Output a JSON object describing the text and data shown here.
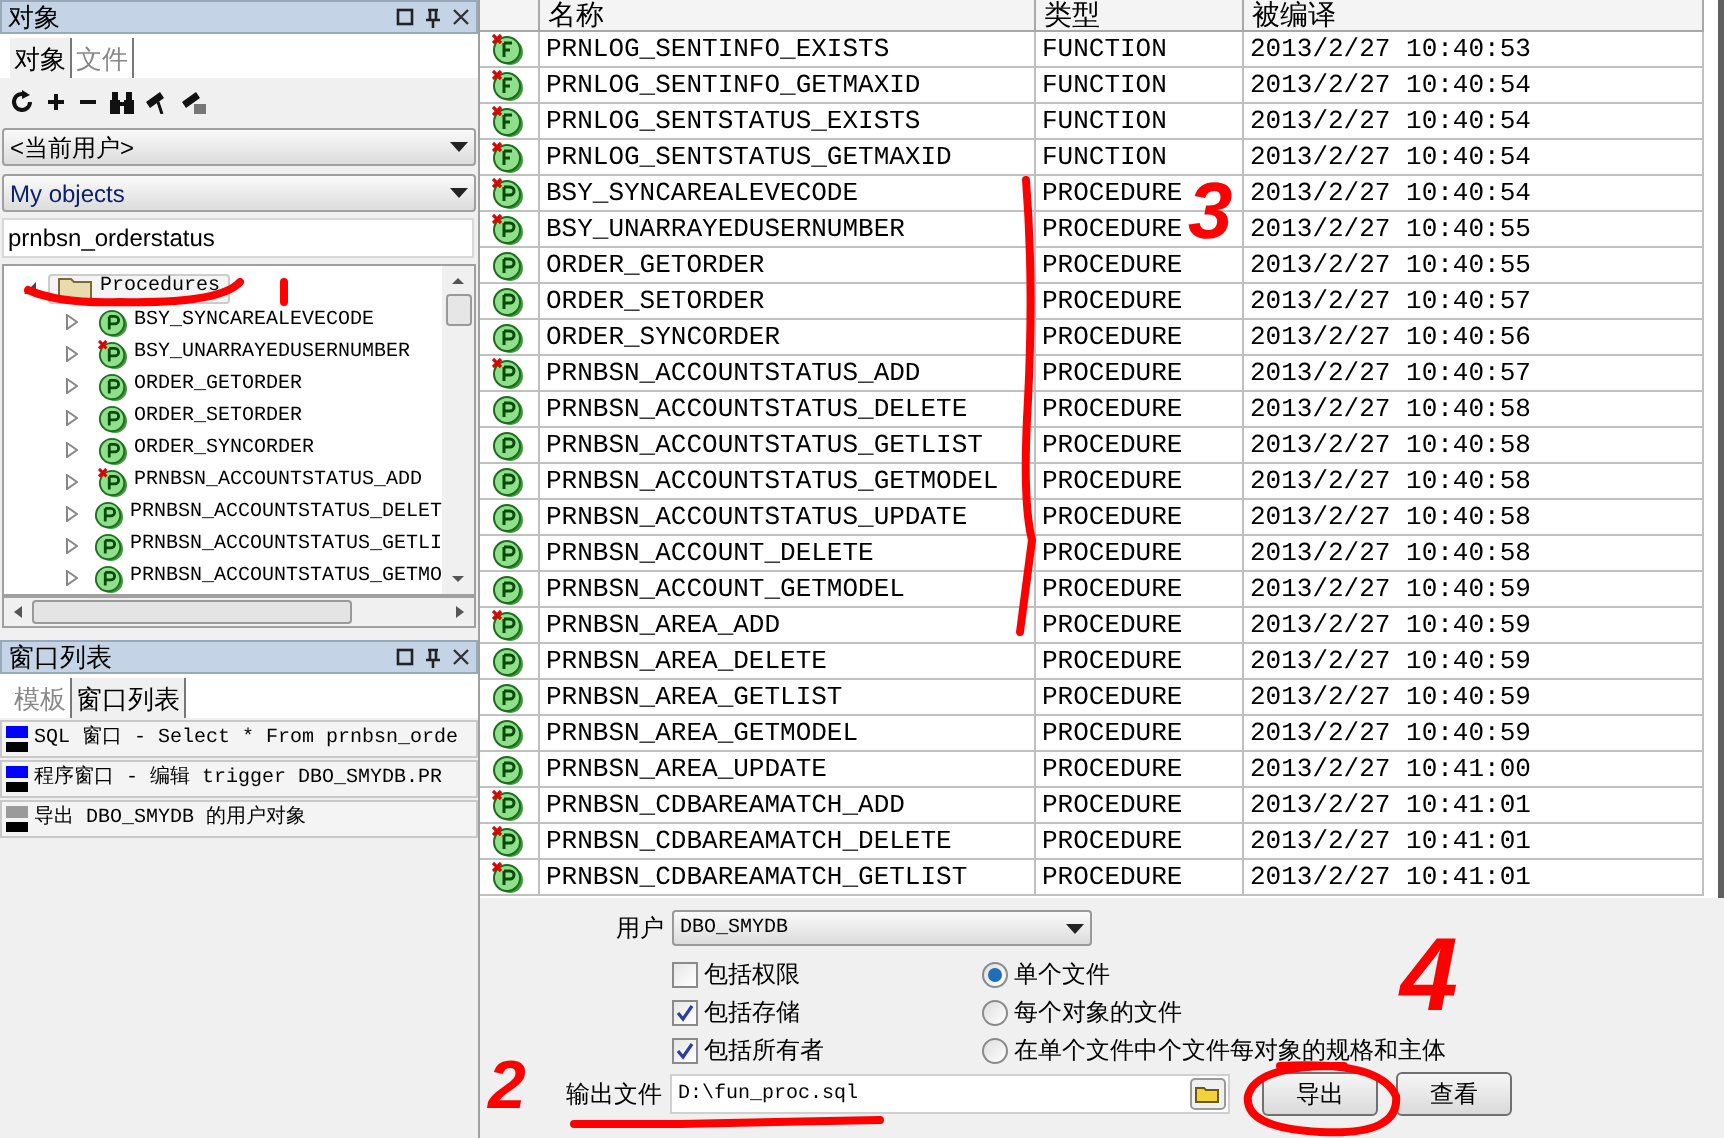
{
  "objects_panel": {
    "title": "对象",
    "tabs": [
      {
        "label": "对象",
        "selected": true
      },
      {
        "label": "文件",
        "selected": false
      }
    ],
    "owner_select": {
      "value": "<当前用户>"
    },
    "filter_select": {
      "value": "My objects"
    },
    "search": {
      "value": "prnbsn_orderstatus"
    },
    "tree": [
      {
        "label": "Procedures",
        "expanded": true,
        "children": [
          {
            "label": "BSY_SYNCAREALEVECODE",
            "invalid": false
          },
          {
            "label": "BSY_UNARRAYEDUSERNUMBER",
            "invalid": true
          },
          {
            "label": "ORDER_GETORDER",
            "invalid": false
          },
          {
            "label": "ORDER_SETORDER",
            "invalid": false
          },
          {
            "label": "ORDER_SYNCORDER",
            "invalid": false
          },
          {
            "label": "PRNBSN_ACCOUNTSTATUS_ADD",
            "invalid": true
          },
          {
            "label": "PRNBSN_ACCOUNTSTATUS_DELET",
            "invalid": false
          },
          {
            "label": "PRNBSN_ACCOUNTSTATUS_GETLI",
            "invalid": false
          },
          {
            "label": "PRNBSN_ACCOUNTSTATUS_GETMO",
            "invalid": false
          }
        ]
      }
    ]
  },
  "window_list_panel": {
    "title": "窗口列表",
    "tabs": [
      {
        "label": "模板",
        "selected": false
      },
      {
        "label": "窗口列表",
        "selected": true
      }
    ],
    "items": [
      {
        "kind": "sql",
        "label": "SQL 窗口 - Select * From prnbsn_orde"
      },
      {
        "kind": "program",
        "label": "程序窗口 - 编辑 trigger DBO_SMYDB.PR"
      },
      {
        "kind": "export",
        "label": "导出 DBO_SMYDB 的用户对象"
      }
    ]
  },
  "table": {
    "columns": [
      "名称",
      "类型",
      "被编译"
    ],
    "rows": [
      {
        "kind": "function",
        "invalid": true,
        "name": "PRNLOG_SENTINFO_EXISTS",
        "type": "FUNCTION",
        "compiled": "2013/2/27 10:40:53"
      },
      {
        "kind": "function",
        "invalid": true,
        "name": "PRNLOG_SENTINFO_GETMAXID",
        "type": "FUNCTION",
        "compiled": "2013/2/27 10:40:54"
      },
      {
        "kind": "function",
        "invalid": true,
        "name": "PRNLOG_SENTSTATUS_EXISTS",
        "type": "FUNCTION",
        "compiled": "2013/2/27 10:40:54"
      },
      {
        "kind": "function",
        "invalid": true,
        "name": "PRNLOG_SENTSTATUS_GETMAXID",
        "type": "FUNCTION",
        "compiled": "2013/2/27 10:40:54"
      },
      {
        "kind": "procedure",
        "invalid": true,
        "name": "BSY_SYNCAREALEVECODE",
        "type": "PROCEDURE",
        "compiled": "2013/2/27 10:40:54"
      },
      {
        "kind": "procedure",
        "invalid": true,
        "name": "BSY_UNARRAYEDUSERNUMBER",
        "type": "PROCEDURE",
        "compiled": "2013/2/27 10:40:55"
      },
      {
        "kind": "procedure",
        "invalid": false,
        "name": "ORDER_GETORDER",
        "type": "PROCEDURE",
        "compiled": "2013/2/27 10:40:55"
      },
      {
        "kind": "procedure",
        "invalid": false,
        "name": "ORDER_SETORDER",
        "type": "PROCEDURE",
        "compiled": "2013/2/27 10:40:57"
      },
      {
        "kind": "procedure",
        "invalid": false,
        "name": "ORDER_SYNCORDER",
        "type": "PROCEDURE",
        "compiled": "2013/2/27 10:40:56"
      },
      {
        "kind": "procedure",
        "invalid": true,
        "name": "PRNBSN_ACCOUNTSTATUS_ADD",
        "type": "PROCEDURE",
        "compiled": "2013/2/27 10:40:57"
      },
      {
        "kind": "procedure",
        "invalid": false,
        "name": "PRNBSN_ACCOUNTSTATUS_DELETE",
        "type": "PROCEDURE",
        "compiled": "2013/2/27 10:40:58"
      },
      {
        "kind": "procedure",
        "invalid": false,
        "name": "PRNBSN_ACCOUNTSTATUS_GETLIST",
        "type": "PROCEDURE",
        "compiled": "2013/2/27 10:40:58"
      },
      {
        "kind": "procedure",
        "invalid": false,
        "name": "PRNBSN_ACCOUNTSTATUS_GETMODEL",
        "type": "PROCEDURE",
        "compiled": "2013/2/27 10:40:58"
      },
      {
        "kind": "procedure",
        "invalid": false,
        "name": "PRNBSN_ACCOUNTSTATUS_UPDATE",
        "type": "PROCEDURE",
        "compiled": "2013/2/27 10:40:58"
      },
      {
        "kind": "procedure",
        "invalid": false,
        "name": "PRNBSN_ACCOUNT_DELETE",
        "type": "PROCEDURE",
        "compiled": "2013/2/27 10:40:58"
      },
      {
        "kind": "procedure",
        "invalid": false,
        "name": "PRNBSN_ACCOUNT_GETMODEL",
        "type": "PROCEDURE",
        "compiled": "2013/2/27 10:40:59"
      },
      {
        "kind": "procedure",
        "invalid": true,
        "name": "PRNBSN_AREA_ADD",
        "type": "PROCEDURE",
        "compiled": "2013/2/27 10:40:59"
      },
      {
        "kind": "procedure",
        "invalid": false,
        "name": "PRNBSN_AREA_DELETE",
        "type": "PROCEDURE",
        "compiled": "2013/2/27 10:40:59"
      },
      {
        "kind": "procedure",
        "invalid": false,
        "name": "PRNBSN_AREA_GETLIST",
        "type": "PROCEDURE",
        "compiled": "2013/2/27 10:40:59"
      },
      {
        "kind": "procedure",
        "invalid": false,
        "name": "PRNBSN_AREA_GETMODEL",
        "type": "PROCEDURE",
        "compiled": "2013/2/27 10:40:59"
      },
      {
        "kind": "procedure",
        "invalid": false,
        "name": "PRNBSN_AREA_UPDATE",
        "type": "PROCEDURE",
        "compiled": "2013/2/27 10:41:00"
      },
      {
        "kind": "procedure",
        "invalid": true,
        "name": "PRNBSN_CDBAREAMATCH_ADD",
        "type": "PROCEDURE",
        "compiled": "2013/2/27 10:41:01"
      },
      {
        "kind": "procedure",
        "invalid": true,
        "name": "PRNBSN_CDBAREAMATCH_DELETE",
        "type": "PROCEDURE",
        "compiled": "2013/2/27 10:41:01"
      },
      {
        "kind": "procedure",
        "invalid": true,
        "name": "PRNBSN_CDBAREAMATCH_GETLIST",
        "type": "PROCEDURE",
        "compiled": "2013/2/27 10:41:01"
      }
    ]
  },
  "export_form": {
    "user_label": "用户",
    "user_value": "DBO_SMYDB",
    "checkboxes": [
      {
        "label": "包括权限",
        "checked": false
      },
      {
        "label": "包括存储",
        "checked": true
      },
      {
        "label": "包括所有者",
        "checked": true
      }
    ],
    "radios": [
      {
        "label": "单个文件",
        "selected": true
      },
      {
        "label": "每个对象的文件",
        "selected": false
      },
      {
        "label": "在单个文件中个文件每对象的规格和主体",
        "selected": false
      }
    ],
    "output_label": "输出文件",
    "output_value": "D:\\fun_proc.sql",
    "buttons": [
      "导出",
      "查看"
    ]
  },
  "annotations": {
    "numbers": [
      "2",
      "3",
      "4"
    ]
  }
}
